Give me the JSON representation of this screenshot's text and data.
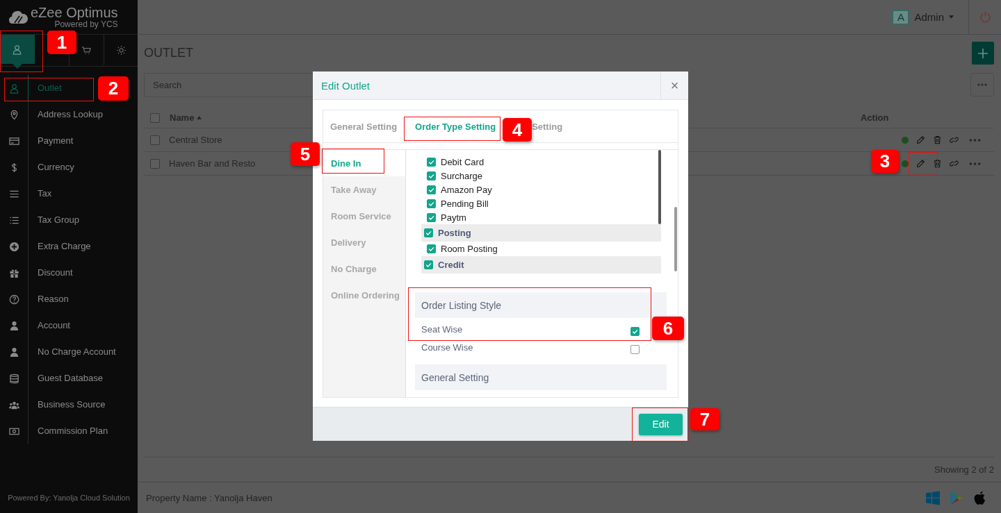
{
  "brand": {
    "name": "eZee Optimus",
    "tagline": "Powered by YCS"
  },
  "module_tabs": [
    {
      "kind": "person",
      "selected": true
    },
    {
      "kind": "cart",
      "selected": false
    },
    {
      "kind": "gear",
      "selected": false
    }
  ],
  "sidebar": {
    "items": [
      {
        "label": "Outlet",
        "kind": "person",
        "selected": true
      },
      {
        "label": "Address Lookup",
        "kind": "pin",
        "selected": false
      },
      {
        "label": "Payment",
        "kind": "card",
        "selected": false
      },
      {
        "label": "Currency",
        "kind": "dollar",
        "selected": false
      },
      {
        "label": "Tax",
        "kind": "bars",
        "selected": false
      },
      {
        "label": "Tax Group",
        "kind": "list",
        "selected": false
      },
      {
        "label": "Extra Charge",
        "kind": "plus",
        "selected": false
      },
      {
        "label": "Discount",
        "kind": "gift",
        "selected": false
      },
      {
        "label": "Reason",
        "kind": "question",
        "selected": false
      },
      {
        "label": "Account",
        "kind": "user",
        "selected": false
      },
      {
        "label": "No Charge Account",
        "kind": "user",
        "selected": false
      },
      {
        "label": "Guest Database",
        "kind": "database",
        "selected": false
      },
      {
        "label": "Business Source",
        "kind": "users",
        "selected": false
      },
      {
        "label": "Commission Plan",
        "kind": "money",
        "selected": false
      }
    ],
    "footer": "Powered By: Yanolja Cloud Solution"
  },
  "header": {
    "avatar": "A",
    "user": "Admin"
  },
  "page": {
    "title": "OUTLET",
    "search": {
      "placeholder": "Search"
    },
    "table": {
      "columns": [
        "Name",
        "Action"
      ],
      "sort_ascending": true,
      "all_checked": false,
      "rows": [
        {
          "name": "Central Store",
          "checked": false,
          "active": true
        },
        {
          "name": "Haven Bar and Resto",
          "checked": false,
          "active": true
        }
      ]
    },
    "count": "Showing 2 of 2"
  },
  "status_bar": {
    "property": "Property Name : Yanolja Haven"
  },
  "modal": {
    "title": "Edit Outlet",
    "close": "×",
    "tabs": [
      {
        "label": "General Setting",
        "selected": false
      },
      {
        "label": "Order Type Setting",
        "selected": true
      },
      {
        "label": "Setting",
        "selected": false
      }
    ],
    "order_types": [
      {
        "label": "Dine In",
        "selected": true
      },
      {
        "label": "Take Away",
        "selected": false
      },
      {
        "label": "Room Service",
        "selected": false
      },
      {
        "label": "Delivery",
        "selected": false
      },
      {
        "label": "No Charge",
        "selected": false
      },
      {
        "label": "Online Ordering",
        "selected": false
      }
    ],
    "payments": [
      {
        "label": "Debit Card",
        "kind": "item",
        "checked": true
      },
      {
        "label": "Surcharge",
        "kind": "item",
        "checked": true
      },
      {
        "label": "Amazon Pay",
        "kind": "item",
        "checked": true
      },
      {
        "label": "Pending Bill",
        "kind": "item",
        "checked": true
      },
      {
        "label": "Paytm",
        "kind": "item",
        "checked": true
      },
      {
        "label": "Posting",
        "kind": "group",
        "checked": true
      },
      {
        "label": "Room Posting",
        "kind": "item",
        "checked": true
      },
      {
        "label": "Credit",
        "kind": "group",
        "checked": true
      }
    ],
    "listing": {
      "title": "Order Listing Style",
      "options": [
        {
          "label": "Seat Wise",
          "checked": true
        },
        {
          "label": "Course Wise",
          "checked": false
        }
      ]
    },
    "general_title": "General Setting",
    "button": "Edit"
  },
  "callouts": [
    {
      "number": "1"
    },
    {
      "number": "2"
    },
    {
      "number": "3"
    },
    {
      "number": "4"
    },
    {
      "number": "5"
    },
    {
      "number": "6"
    },
    {
      "number": "7"
    }
  ]
}
